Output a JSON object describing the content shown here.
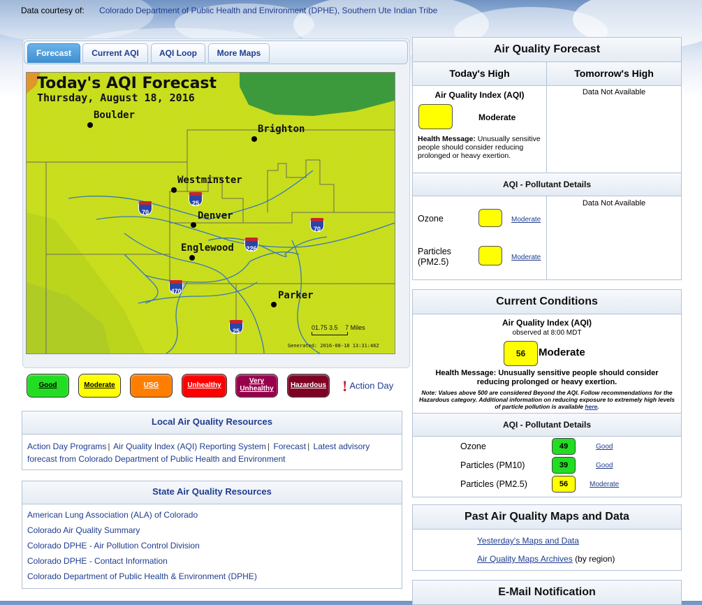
{
  "courtesy": {
    "label": "Data courtesy of:",
    "orgs": "Colorado Department of Public Health and Environment (DPHE), Southern Ute Indian Tribe"
  },
  "tabs": [
    {
      "label": "Forecast",
      "active": true
    },
    {
      "label": "Current AQI",
      "active": false
    },
    {
      "label": "AQI Loop",
      "active": false
    },
    {
      "label": "More Maps",
      "active": false
    }
  ],
  "map": {
    "title": "Today's AQI Forecast",
    "date": "Thursday, August 18, 2016",
    "cities": [
      "Boulder",
      "Brighton",
      "Westminster",
      "Denver",
      "Englewood",
      "Parker"
    ],
    "highways": [
      "70",
      "25",
      "70",
      "226",
      "470",
      "25"
    ],
    "scale": {
      "ticks": "01.75 3.5",
      "unit": "7 Miles"
    },
    "generated": "Generated: 2016-08-18 13:31:46Z",
    "fill_color": "#c9df1e"
  },
  "legend": {
    "good": "Good",
    "moderate": "Moderate",
    "usg": "USG",
    "unhealthy": "Unhealthy",
    "very_unhealthy_1": "Very",
    "very_unhealthy_2": "Unhealthy",
    "hazardous": "Hazardous",
    "action_day": "Action Day",
    "colors": {
      "good": "#00e400",
      "moderate": "#ffff00",
      "usg": "#ff7e00",
      "unhealthy": "#ff0000",
      "very_unhealthy": "#99004c",
      "hazardous": "#7e0023"
    }
  },
  "local_resources": {
    "title": "Local Air Quality Resources",
    "links": [
      "Action Day Programs",
      "Air Quality Index (AQI) Reporting System",
      "Forecast",
      "Latest advisory forecast from Colorado Department of Public Health and Environment"
    ],
    "separator": "|"
  },
  "state_resources": {
    "title": "State Air Quality Resources",
    "links": [
      "American Lung Association (ALA) of Colorado",
      "Colorado Air Quality Summary",
      "Colorado DPHE - Air Pollution Control Division",
      "Colorado DPHE - Contact Information",
      "Colorado Department of Public Health & Environment (DPHE)"
    ]
  },
  "forecast_panel": {
    "title": "Air Quality Forecast",
    "today_header": "Today's High",
    "tomorrow_header": "Tomorrow's High",
    "aqi_label": "Air Quality Index (AQI)",
    "category": "Moderate",
    "health_label": "Health Message:",
    "health_text": "Unusually sensitive people should consider reducing prolonged or heavy exertion.",
    "not_available": "Data Not Available",
    "pollutant_header": "AQI - Pollutant Details",
    "pollutants": [
      {
        "name": "Ozone",
        "category": "Moderate"
      },
      {
        "name": "Particles (PM2.5)",
        "category": "Moderate"
      }
    ],
    "not_available_2": "Data Not Available"
  },
  "current_panel": {
    "title": "Current Conditions",
    "aqi_label": "Air Quality Index (AQI)",
    "observed": "observed at 8:00 MDT",
    "aqi_value": "56",
    "category": "Moderate",
    "health_label": "Health Message:",
    "health_text": "Unusually sensitive people should consider reducing prolonged or heavy exertion.",
    "note_label": "Note:",
    "note_text": "Values above 500 are considered Beyond the AQI. Follow recommendations for the Hazardous category. Additional information on reducing exposure to extremely high levels of particle pollution is available",
    "note_link": "here",
    "pollutant_header": "AQI - Pollutant Details",
    "pollutants": [
      {
        "name": "Ozone",
        "value": "49",
        "category": "Good",
        "color": "#00e400"
      },
      {
        "name": "Particles (PM10)",
        "value": "39",
        "category": "Good",
        "color": "#00e400"
      },
      {
        "name": "Particles (PM2.5)",
        "value": "56",
        "category": "Moderate",
        "color": "#ffff00"
      }
    ]
  },
  "past_panel": {
    "title": "Past Air Quality Maps and Data",
    "link1": "Yesterday's Maps and Data",
    "link2": "Air Quality Maps Archives",
    "link2_suffix": "(by region)"
  },
  "email_panel": {
    "title": "E-Mail Notification"
  }
}
